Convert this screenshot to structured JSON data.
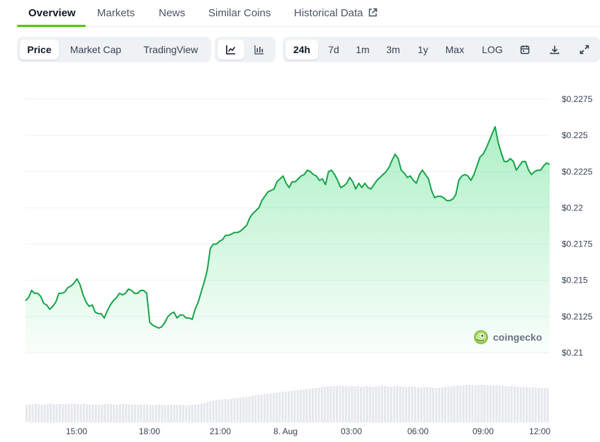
{
  "tabs": [
    {
      "label": "Overview",
      "active": true
    },
    {
      "label": "Markets"
    },
    {
      "label": "News"
    },
    {
      "label": "Similar Coins"
    },
    {
      "label": "Historical Data",
      "icon": "external-link-icon"
    }
  ],
  "chart_type_group": [
    {
      "label": "Price",
      "active": true
    },
    {
      "label": "Market Cap"
    },
    {
      "label": "TradingView"
    }
  ],
  "view_group": [
    {
      "icon": "line-chart-icon",
      "active": true
    },
    {
      "icon": "candlestick-icon"
    }
  ],
  "range_group": [
    {
      "label": "24h",
      "active": true
    },
    {
      "label": "7d"
    },
    {
      "label": "1m"
    },
    {
      "label": "3m"
    },
    {
      "label": "1y"
    },
    {
      "label": "Max"
    },
    {
      "label": "LOG"
    }
  ],
  "tool_icons": [
    "calendar-icon",
    "download-icon",
    "fullscreen-icon"
  ],
  "watermark": {
    "text": "coingecko",
    "icon": "coingecko-logo-icon"
  },
  "colors": {
    "line": "#16a34a",
    "fill": "#4ade80",
    "volume": "#e5e7eb",
    "accent": "#4bcc00"
  },
  "chart_data": {
    "type": "area",
    "y_ticks": [
      "$0.2275",
      "$0.225",
      "$0.2225",
      "$0.22",
      "$0.2175",
      "$0.215",
      "$0.2125",
      "$0.21"
    ],
    "x_ticks": [
      "15:00",
      "18:00",
      "21:00",
      "8. Aug",
      "03:00",
      "06:00",
      "09:00",
      "12:00"
    ],
    "ylim": [
      0.21,
      0.2275
    ],
    "series": [
      {
        "values": [
          0.2136,
          0.2138,
          0.2143,
          0.2141,
          0.2141,
          0.2139,
          0.2134,
          0.2133,
          0.213,
          0.2132,
          0.2135,
          0.2141,
          0.2141,
          0.2142,
          0.2145,
          0.2146,
          0.2148,
          0.2151,
          0.2147,
          0.214,
          0.2135,
          0.2132,
          0.2133,
          0.2128,
          0.2127,
          0.2127,
          0.2124,
          0.2129,
          0.2133,
          0.2136,
          0.2138,
          0.2141,
          0.214,
          0.2141,
          0.2144,
          0.2143,
          0.2141,
          0.2141,
          0.2143,
          0.2143,
          0.2141,
          0.2121,
          0.2119,
          0.2118,
          0.2117,
          0.2118,
          0.2121,
          0.2125,
          0.2127,
          0.2128,
          0.2124,
          0.2126,
          0.2126,
          0.2124,
          0.2124,
          0.2123,
          0.213,
          0.2135,
          0.2142,
          0.2149,
          0.2157,
          0.2172,
          0.2175,
          0.2175,
          0.2177,
          0.2178,
          0.2181,
          0.2181,
          0.2182,
          0.2183,
          0.2183,
          0.2184,
          0.2186,
          0.2188,
          0.2193,
          0.2196,
          0.2198,
          0.22,
          0.2205,
          0.2208,
          0.2211,
          0.2212,
          0.2213,
          0.2218,
          0.222,
          0.2222,
          0.2217,
          0.2214,
          0.2218,
          0.2218,
          0.222,
          0.2222,
          0.2223,
          0.2226,
          0.2225,
          0.2223,
          0.2222,
          0.2219,
          0.222,
          0.2216,
          0.2225,
          0.2226,
          0.2223,
          0.2219,
          0.2214,
          0.2215,
          0.2217,
          0.2221,
          0.2218,
          0.2213,
          0.2217,
          0.2214,
          0.2217,
          0.2214,
          0.2213,
          0.2216,
          0.2219,
          0.2221,
          0.2223,
          0.2225,
          0.2228,
          0.2233,
          0.2237,
          0.2234,
          0.2226,
          0.2224,
          0.2221,
          0.2222,
          0.2219,
          0.2217,
          0.2223,
          0.2226,
          0.2223,
          0.222,
          0.2212,
          0.2207,
          0.2208,
          0.2208,
          0.2207,
          0.2205,
          0.2205,
          0.2206,
          0.2209,
          0.2219,
          0.2222,
          0.2223,
          0.2222,
          0.2219,
          0.2223,
          0.2229,
          0.2235,
          0.2237,
          0.2241,
          0.2246,
          0.2251,
          0.2256,
          0.2245,
          0.2238,
          0.2232,
          0.2232,
          0.2234,
          0.2232,
          0.2226,
          0.2229,
          0.2232,
          0.2232,
          0.2226,
          0.2223,
          0.2225,
          0.2226,
          0.2226,
          0.2229,
          0.2231,
          0.223
        ]
      }
    ],
    "volume": [
      0.45,
      0.47,
      0.46,
      0.48,
      0.47,
      0.45,
      0.46,
      0.47,
      0.48,
      0.46,
      0.47,
      0.48,
      0.47,
      0.46,
      0.47,
      0.49,
      0.48,
      0.47,
      0.46,
      0.48,
      0.47,
      0.46,
      0.47,
      0.46,
      0.45,
      0.46,
      0.47,
      0.48,
      0.47,
      0.46,
      0.46,
      0.47,
      0.48,
      0.47,
      0.46,
      0.47,
      0.46,
      0.45,
      0.46,
      0.47,
      0.46,
      0.45,
      0.44,
      0.45,
      0.46,
      0.45,
      0.44,
      0.45,
      0.46,
      0.45,
      0.44,
      0.45,
      0.44,
      0.43,
      0.44,
      0.45,
      0.46,
      0.47,
      0.48,
      0.5,
      0.52,
      0.55,
      0.57,
      0.58,
      0.59,
      0.6,
      0.61,
      0.6,
      0.62,
      0.63,
      0.64,
      0.65,
      0.66,
      0.67,
      0.68,
      0.7,
      0.71,
      0.72,
      0.73,
      0.74,
      0.75,
      0.76,
      0.77,
      0.78,
      0.79,
      0.8,
      0.81,
      0.82,
      0.83,
      0.84,
      0.85,
      0.86,
      0.87,
      0.88,
      0.89,
      0.9,
      0.91,
      0.92,
      0.93,
      0.94,
      0.95,
      0.96,
      0.95,
      0.96,
      0.97,
      0.96,
      0.95,
      0.96,
      0.97,
      0.96,
      0.95,
      0.94,
      0.95,
      0.96,
      0.95,
      0.94,
      0.95,
      0.96,
      0.97,
      0.96,
      0.95,
      0.94,
      0.95,
      0.96,
      0.95,
      0.94,
      0.93,
      0.94,
      0.95,
      0.94,
      0.93,
      0.92,
      0.93,
      0.94,
      0.93,
      0.92,
      0.91,
      0.92,
      0.93,
      0.94,
      0.95,
      0.96,
      0.97,
      0.98,
      0.97,
      0.98,
      0.99,
      1.0,
      0.99,
      0.98,
      0.99,
      1.0,
      0.99,
      0.98,
      0.97,
      0.98,
      0.99,
      0.98,
      0.97,
      0.96,
      0.95,
      0.96,
      0.95,
      0.94,
      0.93,
      0.94,
      0.93,
      0.92,
      0.93,
      0.92,
      0.91,
      0.9,
      0.91,
      0.9
    ]
  }
}
